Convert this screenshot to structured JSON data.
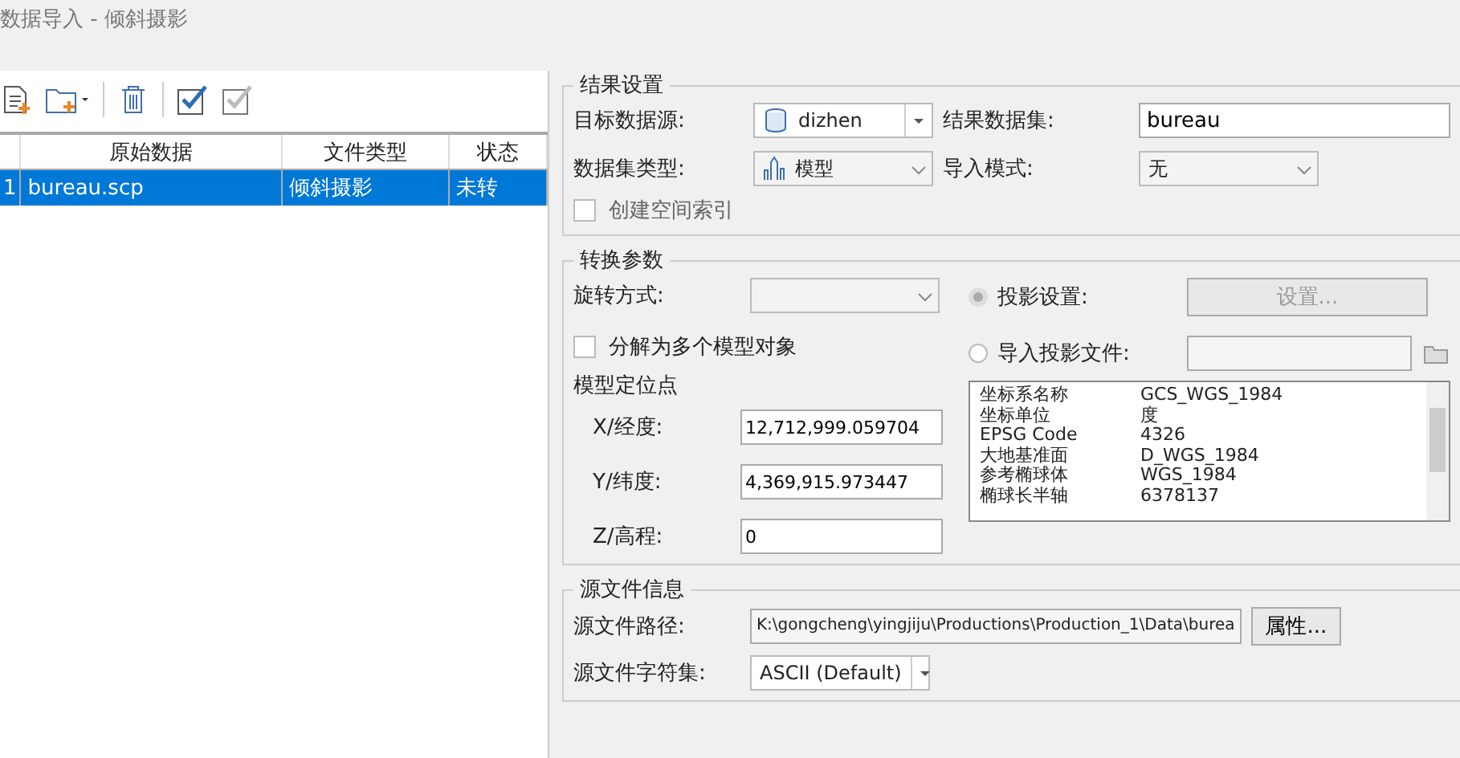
{
  "window": {
    "title": "数据导入 - 倾斜摄影"
  },
  "table": {
    "columns": [
      "",
      "原始数据",
      "文件类型",
      "状态"
    ],
    "rows": [
      {
        "cells": [
          "1",
          "bureau.scp",
          "倾斜摄影",
          "未转"
        ],
        "selected": true
      }
    ]
  },
  "result_settings": {
    "title": "结果设置",
    "target_datasource_label": "目标数据源:",
    "target_datasource": "dizhen",
    "result_dataset_label": "结果数据集:",
    "result_dataset": "bureau",
    "dataset_type_label": "数据集类型:",
    "dataset_type": "模型",
    "import_mode_label": "导入模式:",
    "import_mode": "无",
    "spatial_index": {
      "label": "创建空间索引",
      "checked": false
    }
  },
  "conversion": {
    "title": "转换参数",
    "rotation_label": "旋转方式:",
    "split": {
      "label": "分解为多个模型对象",
      "checked": false
    },
    "anchor_title": "模型定位点",
    "coords": [
      {
        "label": "X/经度:",
        "value": "12,712,999.059704"
      },
      {
        "label": "Y/纬度:",
        "value": "4,369,915.973447"
      },
      {
        "label": "Z/高程:",
        "value": "0"
      }
    ],
    "projection_options": [
      {
        "label": "投影设置:",
        "selected": true
      },
      {
        "label": "导入投影文件:",
        "selected": false
      }
    ],
    "settings_button": "设置...",
    "projection_info": [
      [
        "坐标系名称",
        "GCS_WGS_1984"
      ],
      [
        "坐标单位",
        "度"
      ],
      [
        "EPSG Code",
        "4326"
      ],
      [
        "大地基准面",
        "D_WGS_1984"
      ],
      [
        "参考椭球体",
        "WGS_1984"
      ],
      [
        "椭球长半轴",
        "6378137"
      ]
    ]
  },
  "source": {
    "title": "源文件信息",
    "path_label": "源文件路径:",
    "path": "K:\\gongcheng\\yingjiju\\Productions\\Production_1\\Data\\burea",
    "properties_button": "属性...",
    "charset_label": "源文件字符集:",
    "charset": "ASCII (Default)"
  }
}
